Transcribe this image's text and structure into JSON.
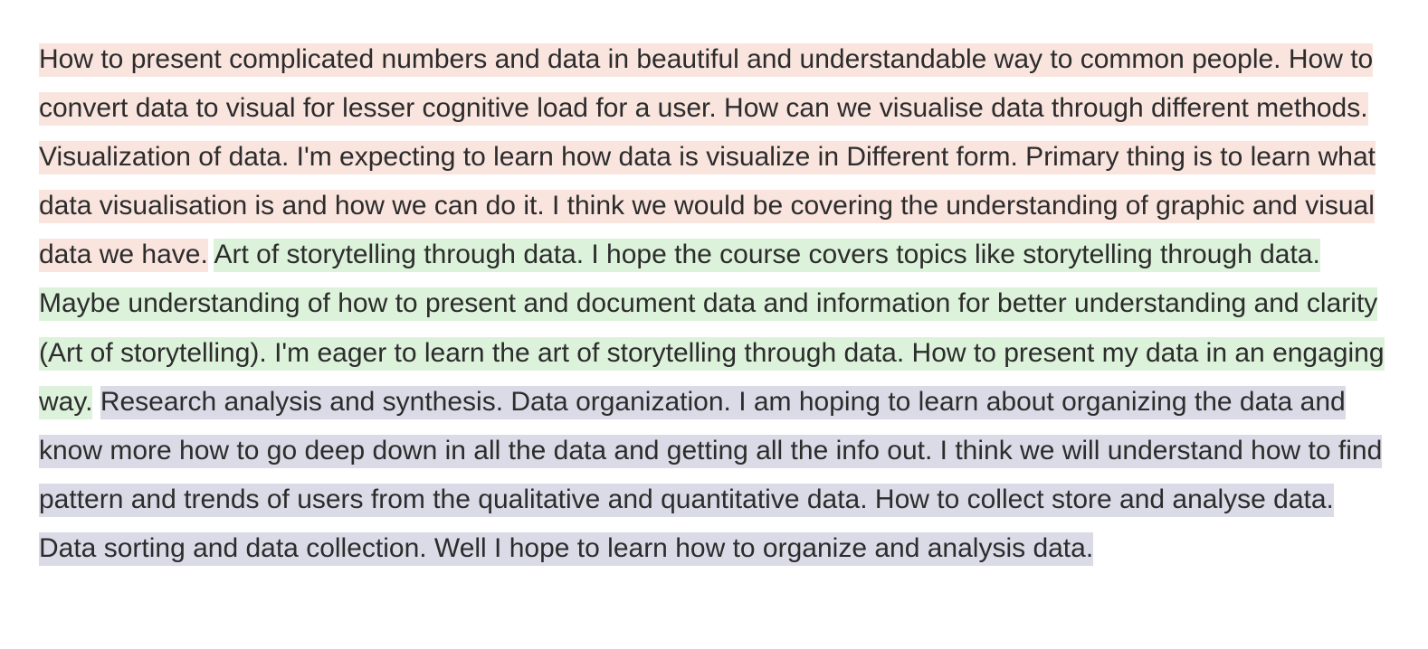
{
  "highlight_colors": {
    "pink": "#f9e4de",
    "green": "#dcf2da",
    "lavender": "#dadbe7",
    "text": "#2c2c2c"
  },
  "groups": [
    {
      "color": "pink",
      "text": "How to present complicated numbers and data in beautiful and understandable way to common people. How to convert data to visual for lesser cognitive load for a user. How can we visualise data through different methods. Visualization of data. I'm expecting to learn how data is visualize in Different form. Primary thing is to learn what data visualisation is and how we can do it. I think we would be covering the understanding of graphic and visual data we have."
    },
    {
      "color": "green",
      "text": "Art of storytelling through data. I hope the course covers topics like storytelling through data. Maybe understanding of how to present and document data and information for better understanding and clarity (Art of storytelling). I'm eager to learn the art of storytelling through data. How to present my data in an engaging way."
    },
    {
      "color": "lavender",
      "text": "Research analysis and synthesis. Data organization. I am hoping to learn about organizing the data and know more how to go deep down in all the data and getting all the info out. I think we will understand how to find pattern and trends of users from the qualitative and quantitative data. How to collect store and analyse data. Data sorting and data collection. Well I hope to learn how to organize and analysis data."
    }
  ]
}
